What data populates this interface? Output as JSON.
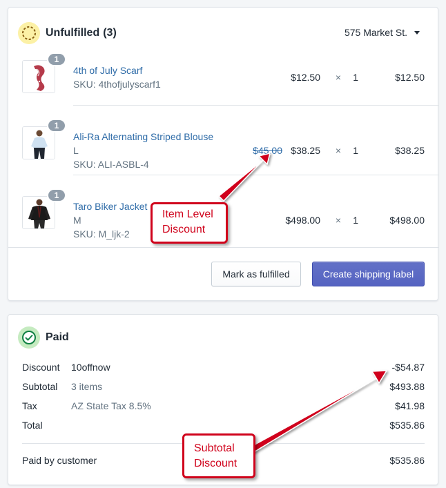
{
  "unfulfilled": {
    "title": "Unfulfilled",
    "count": "(3)",
    "location": "575 Market St.",
    "items": [
      {
        "quantity_badge": "1",
        "title": "4th of July Scarf",
        "variant": "",
        "sku": "SKU: 4thofjulyscarf1",
        "original_price": "",
        "price": "$12.50",
        "times": "×",
        "quantity": "1",
        "total": "$12.50"
      },
      {
        "quantity_badge": "1",
        "title": "Ali-Ra Alternating Striped Blouse",
        "variant": "L",
        "sku": "SKU: ALI-ASBL-4",
        "original_price": "$45.00",
        "price": "$38.25",
        "times": "×",
        "quantity": "1",
        "total": "$38.25"
      },
      {
        "quantity_badge": "1",
        "title": "Taro Biker Jacket",
        "variant": "M",
        "sku": "SKU: M_ljk-2",
        "original_price": "",
        "price": "$498.00",
        "times": "×",
        "quantity": "1",
        "total": "$498.00"
      }
    ],
    "buttons": {
      "mark_fulfilled": "Mark as fulfilled",
      "create_label": "Create shipping label"
    }
  },
  "paid": {
    "title": "Paid",
    "rows": [
      {
        "label": "Discount",
        "desc": "10offnow",
        "amount": "-$54.87"
      },
      {
        "label": "Subtotal",
        "desc": "3 items",
        "amount": "$493.88"
      },
      {
        "label": "Tax",
        "desc": "AZ State Tax 8.5%",
        "amount": "$41.98"
      },
      {
        "label": "Total",
        "desc": "",
        "amount": "$535.86"
      }
    ],
    "paid_by": {
      "label": "Paid by customer",
      "amount": "$535.86"
    }
  },
  "annotations": {
    "item_level": {
      "line1": "Item Level",
      "line2": "Discount"
    },
    "subtotal": {
      "line1": "Subtotal",
      "line2": "Discount"
    }
  },
  "colors": {
    "link": "#2f6ca8",
    "primary_button": "#5c6ac4",
    "annotation_red": "#d0021b",
    "unfulfilled_badge": "#fcf1a6",
    "paid_badge": "#c5ebc0"
  }
}
